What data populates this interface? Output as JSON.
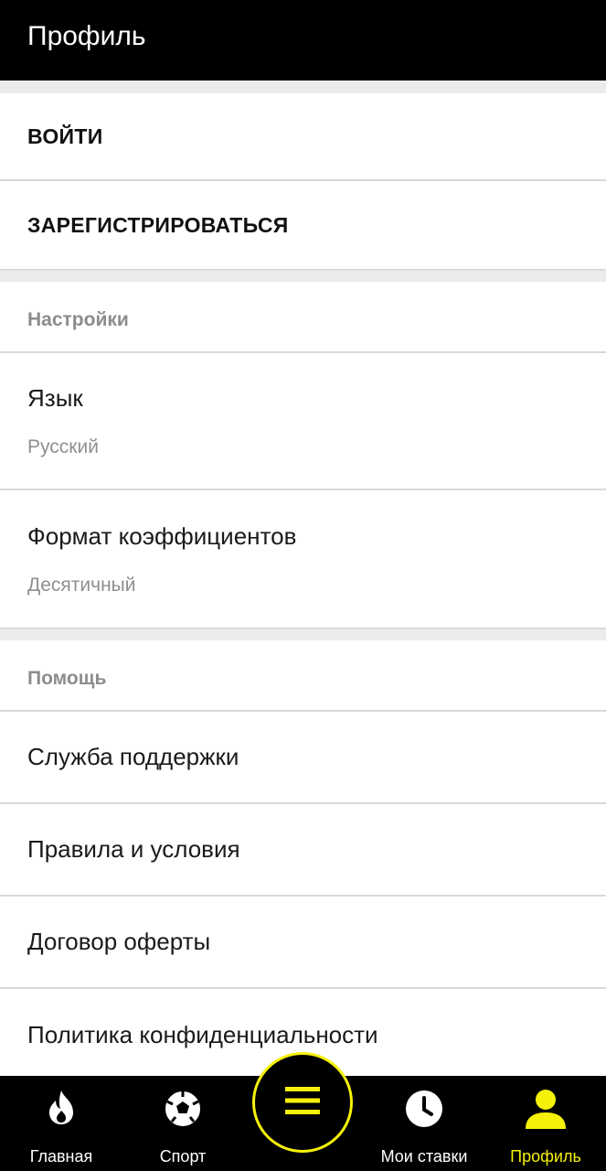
{
  "header": {
    "title": "Профиль"
  },
  "auth": {
    "login_label": "ВОЙТИ",
    "register_label": "ЗАРЕГИСТРИРОВАТЬСЯ"
  },
  "settings": {
    "section_title": "Настройки",
    "items": [
      {
        "label": "Язык",
        "value": "Русский"
      },
      {
        "label": "Формат коэффициентов",
        "value": "Десятичный"
      }
    ]
  },
  "help": {
    "section_title": "Помощь",
    "items": [
      {
        "label": "Служба поддержки"
      },
      {
        "label": "Правила и условия"
      },
      {
        "label": "Договор оферты"
      },
      {
        "label": "Политика конфиденциальности"
      }
    ]
  },
  "bottom_nav": {
    "items": [
      {
        "label": "Главная",
        "icon": "flame-icon"
      },
      {
        "label": "Спорт",
        "icon": "soccer-ball-icon"
      },
      {
        "label": "Мои ставки",
        "icon": "clock-icon"
      },
      {
        "label": "Профиль",
        "icon": "user-icon",
        "active": true
      }
    ],
    "menu_icon": "menu-icon"
  },
  "colors": {
    "accent": "#f5f10a",
    "header_bg": "#000000",
    "page_bg": "#ececec",
    "muted_text": "#8c8c8c"
  }
}
